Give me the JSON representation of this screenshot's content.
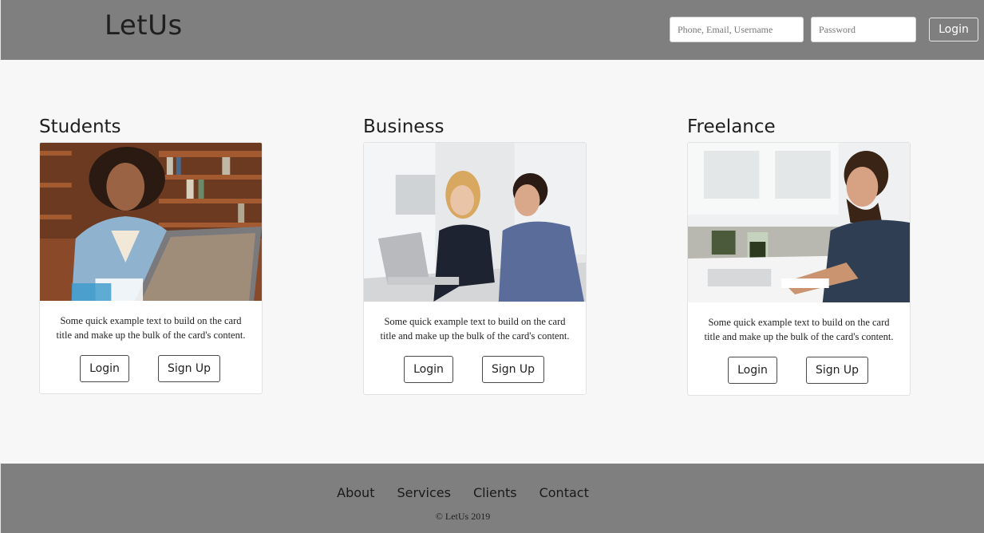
{
  "header": {
    "brand": "LetUs",
    "username_placeholder": "Phone, Email, Username",
    "password_placeholder": "Password",
    "login_label": "Login"
  },
  "cards": [
    {
      "title": "Students",
      "text": "Some quick example text to build on the card title and make up the bulk of the card's content.",
      "login_label": "Login",
      "signup_label": "Sign Up"
    },
    {
      "title": "Business",
      "text": "Some quick example text to build on the card title and make up the bulk of the card's content.",
      "login_label": "Login",
      "signup_label": "Sign Up"
    },
    {
      "title": "Freelance",
      "text": "Some quick example text to build on the card title and make up the bulk of the card's content.",
      "login_label": "Login",
      "signup_label": "Sign Up"
    }
  ],
  "footer": {
    "links": [
      "About",
      "Services",
      "Clients",
      "Contact"
    ],
    "copyright": "© LetUs 2019"
  },
  "colors": {
    "header_bg": "#7f7f7f",
    "page_bg": "#f7f7f7",
    "card_bg": "#ffffff"
  }
}
